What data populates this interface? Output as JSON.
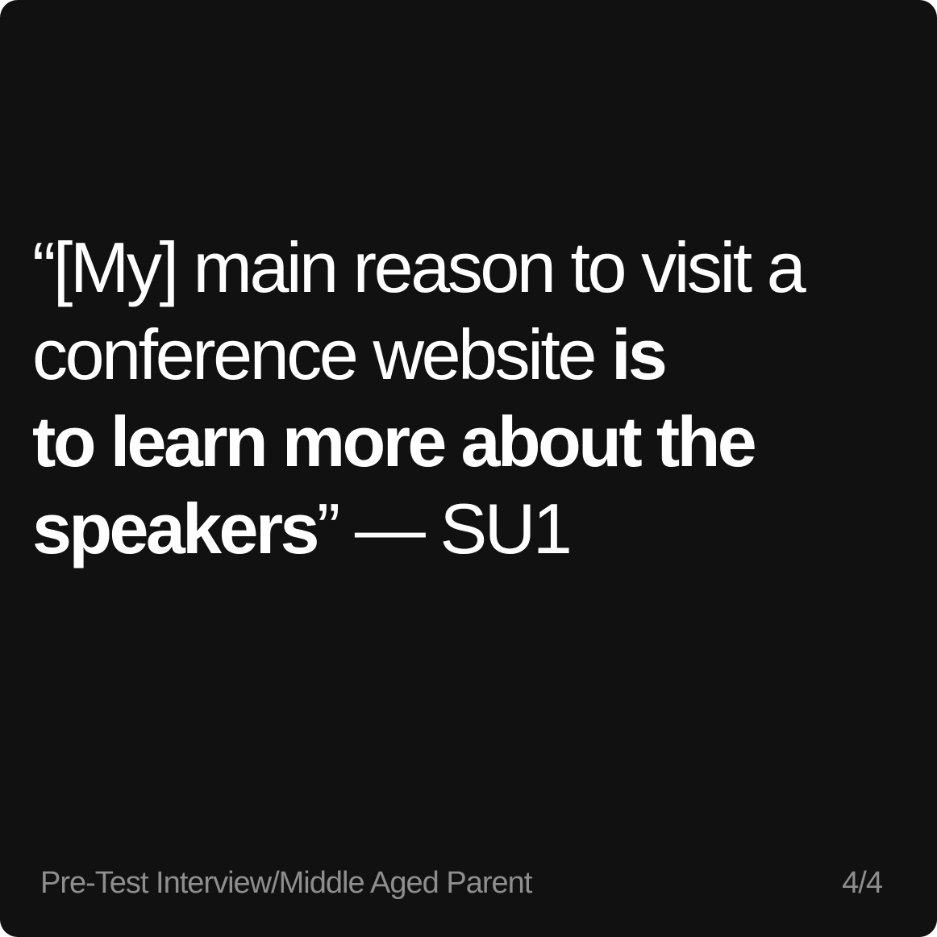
{
  "quote": {
    "part1": "“[My] main reason to visit a conference website ",
    "part2_bold": "is",
    "part3_bold": "to learn more about the speakers",
    "part4": "” — SU1"
  },
  "footer": {
    "source": "Pre-Test Interview/Middle Aged Parent",
    "page_indicator": "4/4"
  },
  "colors": {
    "background": "#111111",
    "text": "#ffffff",
    "muted": "#8e8e8e"
  }
}
